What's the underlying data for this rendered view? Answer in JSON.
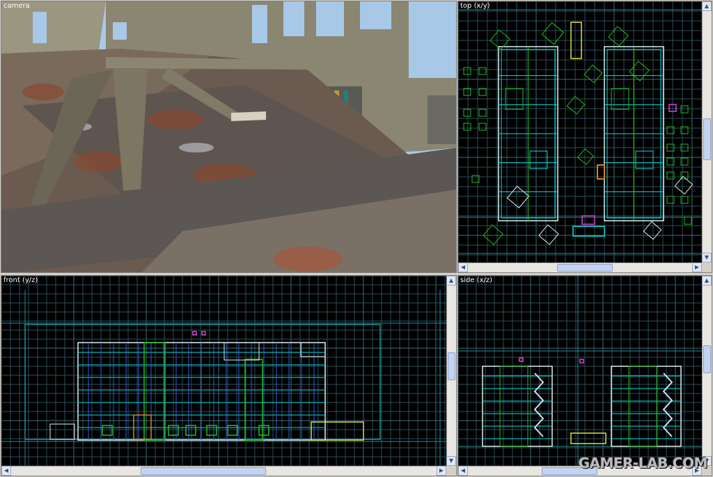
{
  "viewports": {
    "camera": {
      "label": "camera"
    },
    "top": {
      "label": "top (x/y)"
    },
    "front": {
      "label": "front (y/z)"
    },
    "side": {
      "label": "side (x/z)"
    }
  },
  "scrollbar": {
    "left_arrow": "◀",
    "right_arrow": "▶",
    "up_arrow": "▲",
    "down_arrow": "▼",
    "grip": "≡"
  },
  "watermark": "GAMER-LAB.COM",
  "colors": {
    "grid": "#2b4f5a",
    "grid_major": "#3f6f7a",
    "axis": "#1f8f9a",
    "brush_cyan": "#00e5e5",
    "brush_green": "#20c020",
    "brush_white": "#e0f0f0",
    "brush_magenta": "#e040e0",
    "brush_yellow": "#e0e040",
    "sky": "#a8c8e8"
  }
}
